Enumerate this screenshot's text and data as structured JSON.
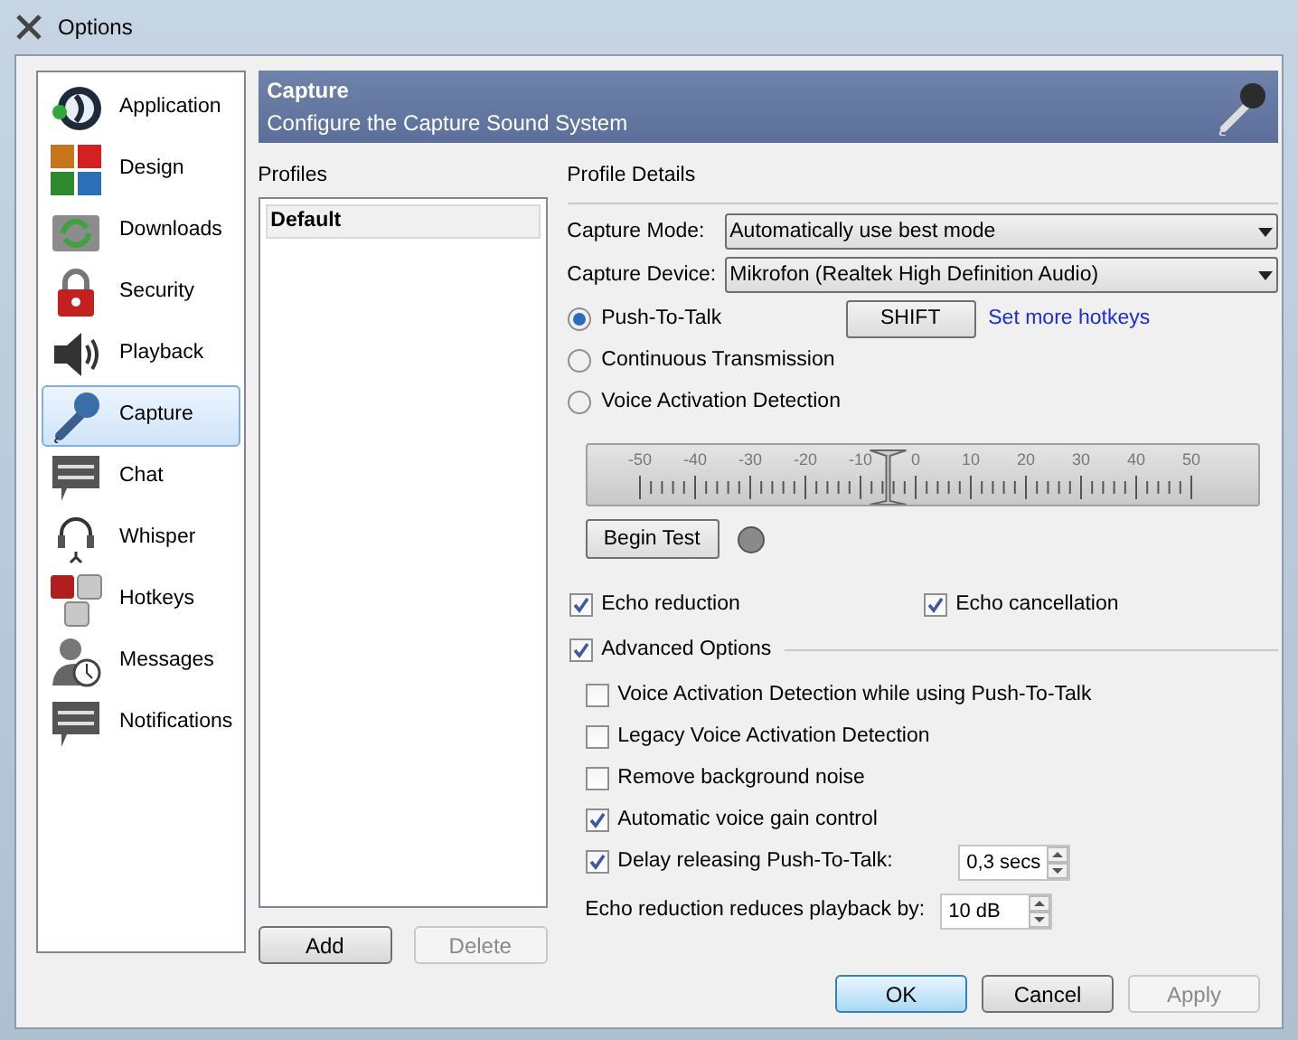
{
  "window": {
    "title": "Options"
  },
  "sidebar": {
    "items": [
      {
        "label": "Application",
        "selected": false
      },
      {
        "label": "Design",
        "selected": false
      },
      {
        "label": "Downloads",
        "selected": false
      },
      {
        "label": "Security",
        "selected": false
      },
      {
        "label": "Playback",
        "selected": false
      },
      {
        "label": "Capture",
        "selected": true
      },
      {
        "label": "Chat",
        "selected": false
      },
      {
        "label": "Whisper",
        "selected": false
      },
      {
        "label": "Hotkeys",
        "selected": false
      },
      {
        "label": "Messages",
        "selected": false
      },
      {
        "label": "Notifications",
        "selected": false
      }
    ]
  },
  "header": {
    "title": "Capture",
    "subtitle": "Configure the Capture Sound System"
  },
  "profiles": {
    "title": "Profiles",
    "items": [
      {
        "label": "Default",
        "selected": true
      }
    ],
    "buttons": [
      {
        "label": "Add",
        "disabled": false
      },
      {
        "label": "Delete",
        "disabled": true
      }
    ]
  },
  "details": {
    "title": "Profile Details",
    "dropdowns": [
      {
        "label": "Capture Mode:",
        "value": "Automatically use best mode"
      },
      {
        "label": "Capture Device:",
        "value": "Mikrofon (Realtek High Definition Audio)"
      }
    ],
    "modes": [
      {
        "label": "Push-To-Talk",
        "selected": true
      },
      {
        "label": "Continuous Transmission",
        "selected": false
      },
      {
        "label": "Voice Activation Detection",
        "selected": false
      }
    ],
    "hotkey_button": "SHIFT",
    "hotkeys_link": "Set more hotkeys",
    "threshold": {
      "scale": [
        "-50",
        "-40",
        "-30",
        "-20",
        "-10",
        "0",
        "10",
        "20",
        "30",
        "40",
        "50"
      ],
      "level": 0.45
    },
    "test_button": "Begin Test",
    "test_light_on": false,
    "echo": [
      {
        "label": "Echo reduction",
        "checked": true
      },
      {
        "label": "Echo cancellation",
        "checked": true
      }
    ],
    "advanced": {
      "label": "Advanced Options",
      "checked": true
    },
    "advanced_options": [
      {
        "label": "Voice Activation Detection while using Push-To-Talk",
        "checked": false
      },
      {
        "label": "Legacy Voice Activation Detection",
        "checked": false
      },
      {
        "label": "Remove background noise",
        "checked": false
      },
      {
        "label": "Automatic voice gain control",
        "checked": true
      },
      {
        "label": "Delay releasing Push-To-Talk:",
        "checked": true,
        "spin": "0,3 secs"
      }
    ],
    "echo_reduction": {
      "label": "Echo reduction reduces playback by:",
      "spin": "10 dB"
    }
  },
  "buttons": [
    {
      "label": "OK",
      "default": true,
      "disabled": false
    },
    {
      "label": "Cancel",
      "default": false,
      "disabled": false
    },
    {
      "label": "Apply",
      "default": false,
      "disabled": true
    }
  ]
}
